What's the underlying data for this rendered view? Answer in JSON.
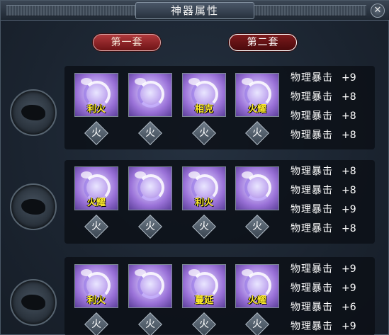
{
  "window": {
    "title": "神器属性",
    "close": "✕"
  },
  "sets": [
    "第一套",
    "第二套"
  ],
  "rows": [
    {
      "items": [
        {
          "skill": "利火",
          "element": "火"
        },
        {
          "skill": "",
          "element": "火"
        },
        {
          "skill": "相克",
          "element": "火"
        },
        {
          "skill": "火耀",
          "element": "火"
        }
      ],
      "stats": [
        {
          "name": "物理暴击",
          "value": "+9"
        },
        {
          "name": "物理暴击",
          "value": "+8"
        },
        {
          "name": "物理暴击",
          "value": "+8"
        },
        {
          "name": "物理暴击",
          "value": "+8"
        }
      ]
    },
    {
      "items": [
        {
          "skill": "火耀",
          "element": "火"
        },
        {
          "skill": "",
          "element": "火"
        },
        {
          "skill": "利火",
          "element": "火"
        },
        {
          "skill": "",
          "element": "火"
        }
      ],
      "stats": [
        {
          "name": "物理暴击",
          "value": "+8"
        },
        {
          "name": "物理暴击",
          "value": "+8"
        },
        {
          "name": "物理暴击",
          "value": "+9"
        },
        {
          "name": "物理暴击",
          "value": "+8"
        }
      ]
    },
    {
      "items": [
        {
          "skill": "利火",
          "element": "火"
        },
        {
          "skill": "",
          "element": "火"
        },
        {
          "skill": "蔓延",
          "element": "火"
        },
        {
          "skill": "火耀",
          "element": "火"
        }
      ],
      "stats": [
        {
          "name": "物理暴击",
          "value": "+9"
        },
        {
          "name": "物理暴击",
          "value": "+9"
        },
        {
          "name": "物理暴击",
          "value": "+6"
        },
        {
          "name": "物理暴击",
          "value": "+9"
        }
      ]
    }
  ]
}
